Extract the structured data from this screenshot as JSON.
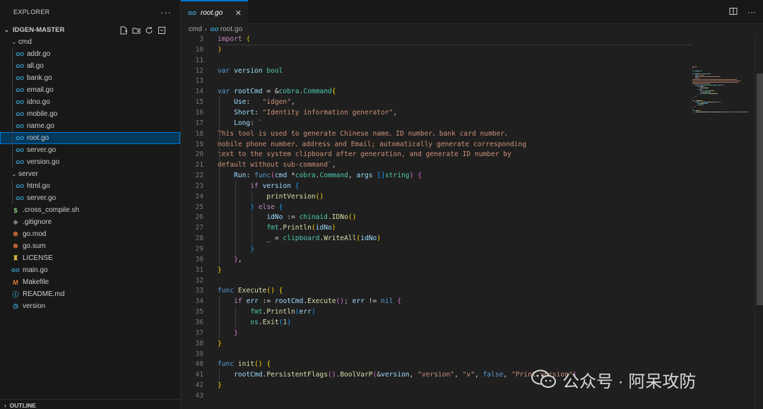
{
  "sidebar": {
    "title": "EXPLORER",
    "more": "···",
    "root_folder": "IDGEN-MASTER",
    "items": [
      {
        "label": "cmd",
        "kind": "folder",
        "depth": 1
      },
      {
        "label": "addr.go",
        "kind": "go",
        "depth": 2
      },
      {
        "label": "all.go",
        "kind": "go",
        "depth": 2
      },
      {
        "label": "bank.go",
        "kind": "go",
        "depth": 2
      },
      {
        "label": "email.go",
        "kind": "go",
        "depth": 2
      },
      {
        "label": "idno.go",
        "kind": "go",
        "depth": 2
      },
      {
        "label": "mobile.go",
        "kind": "go",
        "depth": 2
      },
      {
        "label": "name.go",
        "kind": "go",
        "depth": 2
      },
      {
        "label": "root.go",
        "kind": "go",
        "depth": 2,
        "selected": true
      },
      {
        "label": "server.go",
        "kind": "go",
        "depth": 2
      },
      {
        "label": "version.go",
        "kind": "go",
        "depth": 2
      },
      {
        "label": "server",
        "kind": "folder",
        "depth": 1
      },
      {
        "label": "html.go",
        "kind": "go",
        "depth": 2
      },
      {
        "label": "server.go",
        "kind": "go",
        "depth": 2
      },
      {
        "label": ".cross_compile.sh",
        "kind": "sh",
        "depth": 1
      },
      {
        "label": ".gitignore",
        "kind": "git",
        "depth": 1
      },
      {
        "label": "go.mod",
        "kind": "mod",
        "depth": 1
      },
      {
        "label": "go.sum",
        "kind": "sum",
        "depth": 1
      },
      {
        "label": "LICENSE",
        "kind": "license",
        "depth": 1
      },
      {
        "label": "main.go",
        "kind": "go",
        "depth": 1
      },
      {
        "label": "Makefile",
        "kind": "make",
        "depth": 1
      },
      {
        "label": "README.md",
        "kind": "info",
        "depth": 1
      },
      {
        "label": "version",
        "kind": "ver",
        "depth": 1
      }
    ],
    "outline_label": "OUTLINE"
  },
  "tabs": [
    {
      "label": "root.go",
      "close": "✕"
    }
  ],
  "breadcrumb": {
    "folder": "cmd",
    "file": "root.go"
  },
  "editor": {
    "lines": [
      {
        "n": "3",
        "tokens": [
          [
            "kw2",
            "import"
          ],
          [
            "plain",
            " "
          ],
          [
            "p1",
            "("
          ]
        ]
      },
      {
        "n": "10",
        "tokens": [
          [
            "p1",
            ")"
          ]
        ]
      },
      {
        "n": "11",
        "tokens": []
      },
      {
        "n": "12",
        "tokens": [
          [
            "kw",
            "var"
          ],
          [
            "plain",
            " "
          ],
          [
            "var",
            "version"
          ],
          [
            "plain",
            " "
          ],
          [
            "ty",
            "bool"
          ]
        ]
      },
      {
        "n": "13",
        "tokens": []
      },
      {
        "n": "14",
        "tokens": [
          [
            "kw",
            "var"
          ],
          [
            "plain",
            " "
          ],
          [
            "var",
            "rootCmd"
          ],
          [
            "plain",
            " = &"
          ],
          [
            "ty",
            "cobra"
          ],
          [
            "plain",
            "."
          ],
          [
            "ty",
            "Command"
          ],
          [
            "p1",
            "{"
          ]
        ]
      },
      {
        "n": "15",
        "tokens": [
          [
            "plain",
            "    "
          ],
          [
            "var",
            "Use"
          ],
          [
            "plain",
            ":   "
          ],
          [
            "str",
            "\"idgen\""
          ],
          [
            "plain",
            ","
          ]
        ]
      },
      {
        "n": "16",
        "tokens": [
          [
            "plain",
            "    "
          ],
          [
            "var",
            "Short"
          ],
          [
            "plain",
            ": "
          ],
          [
            "str",
            "\"Identity information generator\""
          ],
          [
            "plain",
            ","
          ]
        ]
      },
      {
        "n": "17",
        "tokens": [
          [
            "plain",
            "    "
          ],
          [
            "var",
            "Long"
          ],
          [
            "plain",
            ": "
          ],
          [
            "str",
            "`"
          ]
        ]
      },
      {
        "n": "18",
        "tokens": [
          [
            "str",
            "This tool is used to generate Chinese name、ID number、bank card number、"
          ]
        ]
      },
      {
        "n": "19",
        "tokens": [
          [
            "str",
            "mobile phone number、address and Email; automatically generate corresponding"
          ]
        ]
      },
      {
        "n": "20",
        "tokens": [
          [
            "str",
            "text to the system clipboard after generation, and generate ID number by"
          ]
        ]
      },
      {
        "n": "21",
        "tokens": [
          [
            "str",
            "default without sub-command`"
          ],
          [
            "plain",
            ","
          ]
        ]
      },
      {
        "n": "22",
        "tokens": [
          [
            "plain",
            "    "
          ],
          [
            "var",
            "Run"
          ],
          [
            "plain",
            ": "
          ],
          [
            "kw",
            "func"
          ],
          [
            "p2",
            "("
          ],
          [
            "var",
            "cmd"
          ],
          [
            "plain",
            " *"
          ],
          [
            "ty",
            "cobra"
          ],
          [
            "plain",
            "."
          ],
          [
            "ty",
            "Command"
          ],
          [
            "plain",
            ", "
          ],
          [
            "var",
            "args"
          ],
          [
            "plain",
            " "
          ],
          [
            "p3",
            "[]"
          ],
          [
            "ty",
            "string"
          ],
          [
            "p2",
            ")"
          ],
          [
            "plain",
            " "
          ],
          [
            "p2",
            "{"
          ]
        ]
      },
      {
        "n": "23",
        "tokens": [
          [
            "plain",
            "        "
          ],
          [
            "kw2",
            "if"
          ],
          [
            "plain",
            " "
          ],
          [
            "var",
            "version"
          ],
          [
            "plain",
            " "
          ],
          [
            "p3",
            "{"
          ]
        ]
      },
      {
        "n": "24",
        "tokens": [
          [
            "plain",
            "            "
          ],
          [
            "fn",
            "printVersion"
          ],
          [
            "p1",
            "()"
          ]
        ]
      },
      {
        "n": "25",
        "tokens": [
          [
            "plain",
            "        "
          ],
          [
            "p3",
            "}"
          ],
          [
            "plain",
            " "
          ],
          [
            "kw2",
            "else"
          ],
          [
            "plain",
            " "
          ],
          [
            "p3",
            "{"
          ]
        ]
      },
      {
        "n": "26",
        "tokens": [
          [
            "plain",
            "            "
          ],
          [
            "var",
            "idNo"
          ],
          [
            "plain",
            " := "
          ],
          [
            "ty",
            "chinaid"
          ],
          [
            "plain",
            "."
          ],
          [
            "fn",
            "IDNo"
          ],
          [
            "p1",
            "()"
          ]
        ]
      },
      {
        "n": "27",
        "tokens": [
          [
            "plain",
            "            "
          ],
          [
            "ty",
            "fmt"
          ],
          [
            "plain",
            "."
          ],
          [
            "fn",
            "Println"
          ],
          [
            "p1",
            "("
          ],
          [
            "var",
            "idNo"
          ],
          [
            "p1",
            ")"
          ]
        ]
      },
      {
        "n": "28",
        "tokens": [
          [
            "plain",
            "            "
          ],
          [
            "var",
            "_"
          ],
          [
            "plain",
            " = "
          ],
          [
            "ty",
            "clipboard"
          ],
          [
            "plain",
            "."
          ],
          [
            "fn",
            "WriteAll"
          ],
          [
            "p1",
            "("
          ],
          [
            "var",
            "idNo"
          ],
          [
            "p1",
            ")"
          ]
        ]
      },
      {
        "n": "29",
        "tokens": [
          [
            "plain",
            "        "
          ],
          [
            "p3",
            "}"
          ]
        ]
      },
      {
        "n": "30",
        "tokens": [
          [
            "plain",
            "    "
          ],
          [
            "p2",
            "}"
          ],
          [
            "plain",
            ","
          ]
        ]
      },
      {
        "n": "31",
        "tokens": [
          [
            "p1",
            "}"
          ]
        ]
      },
      {
        "n": "32",
        "tokens": []
      },
      {
        "n": "33",
        "tokens": [
          [
            "kw",
            "func"
          ],
          [
            "plain",
            " "
          ],
          [
            "fn",
            "Execute"
          ],
          [
            "p1",
            "()"
          ],
          [
            "plain",
            " "
          ],
          [
            "p1",
            "{"
          ]
        ]
      },
      {
        "n": "34",
        "tokens": [
          [
            "plain",
            "    "
          ],
          [
            "kw2",
            "if"
          ],
          [
            "plain",
            " "
          ],
          [
            "var",
            "err"
          ],
          [
            "plain",
            " := "
          ],
          [
            "var",
            "rootCmd"
          ],
          [
            "plain",
            "."
          ],
          [
            "fn",
            "Execute"
          ],
          [
            "p2",
            "()"
          ],
          [
            "plain",
            "; "
          ],
          [
            "var",
            "err"
          ],
          [
            "plain",
            " != "
          ],
          [
            "kw",
            "nil"
          ],
          [
            "plain",
            " "
          ],
          [
            "p2",
            "{"
          ]
        ]
      },
      {
        "n": "35",
        "tokens": [
          [
            "plain",
            "        "
          ],
          [
            "ty",
            "fmt"
          ],
          [
            "plain",
            "."
          ],
          [
            "fn",
            "Println"
          ],
          [
            "p3",
            "("
          ],
          [
            "var",
            "err"
          ],
          [
            "p3",
            ")"
          ]
        ]
      },
      {
        "n": "36",
        "tokens": [
          [
            "plain",
            "        "
          ],
          [
            "ty",
            "os"
          ],
          [
            "plain",
            "."
          ],
          [
            "fn",
            "Exit"
          ],
          [
            "p3",
            "("
          ],
          [
            "num",
            "1"
          ],
          [
            "p3",
            ")"
          ]
        ]
      },
      {
        "n": "37",
        "tokens": [
          [
            "plain",
            "    "
          ],
          [
            "p2",
            "}"
          ]
        ]
      },
      {
        "n": "38",
        "tokens": [
          [
            "p1",
            "}"
          ]
        ]
      },
      {
        "n": "39",
        "tokens": []
      },
      {
        "n": "40",
        "tokens": [
          [
            "kw",
            "func"
          ],
          [
            "plain",
            " "
          ],
          [
            "fn",
            "init"
          ],
          [
            "p1",
            "()"
          ],
          [
            "plain",
            " "
          ],
          [
            "p1",
            "{"
          ]
        ]
      },
      {
        "n": "41",
        "tokens": [
          [
            "plain",
            "    "
          ],
          [
            "var",
            "rootCmd"
          ],
          [
            "plain",
            "."
          ],
          [
            "fn",
            "PersistentFlags"
          ],
          [
            "p2",
            "()"
          ],
          [
            "plain",
            "."
          ],
          [
            "fn",
            "BoolVarP"
          ],
          [
            "p2",
            "("
          ],
          [
            "plain",
            "&"
          ],
          [
            "var",
            "version"
          ],
          [
            "plain",
            ", "
          ],
          [
            "str",
            "\"version\""
          ],
          [
            "plain",
            ", "
          ],
          [
            "str",
            "\"v\""
          ],
          [
            "plain",
            ", "
          ],
          [
            "kw",
            "false"
          ],
          [
            "plain",
            ", "
          ],
          [
            "str",
            "\"Print version\""
          ],
          [
            "p2",
            ")"
          ]
        ]
      },
      {
        "n": "42",
        "tokens": [
          [
            "p1",
            "}"
          ]
        ]
      },
      {
        "n": "43",
        "tokens": []
      }
    ]
  },
  "watermark": {
    "text": "公众号 · 阿呆攻防"
  },
  "colors": {
    "accent": "#0078d4",
    "selection": "#04395e",
    "editor_bg": "#1f1f1f",
    "sidebar_bg": "#181818"
  },
  "icons": {
    "new_file": "new-file-icon",
    "new_folder": "new-folder-icon",
    "refresh": "refresh-icon",
    "collapse": "collapse-all-icon",
    "split": "split-editor-icon",
    "more": "more-actions-icon"
  }
}
